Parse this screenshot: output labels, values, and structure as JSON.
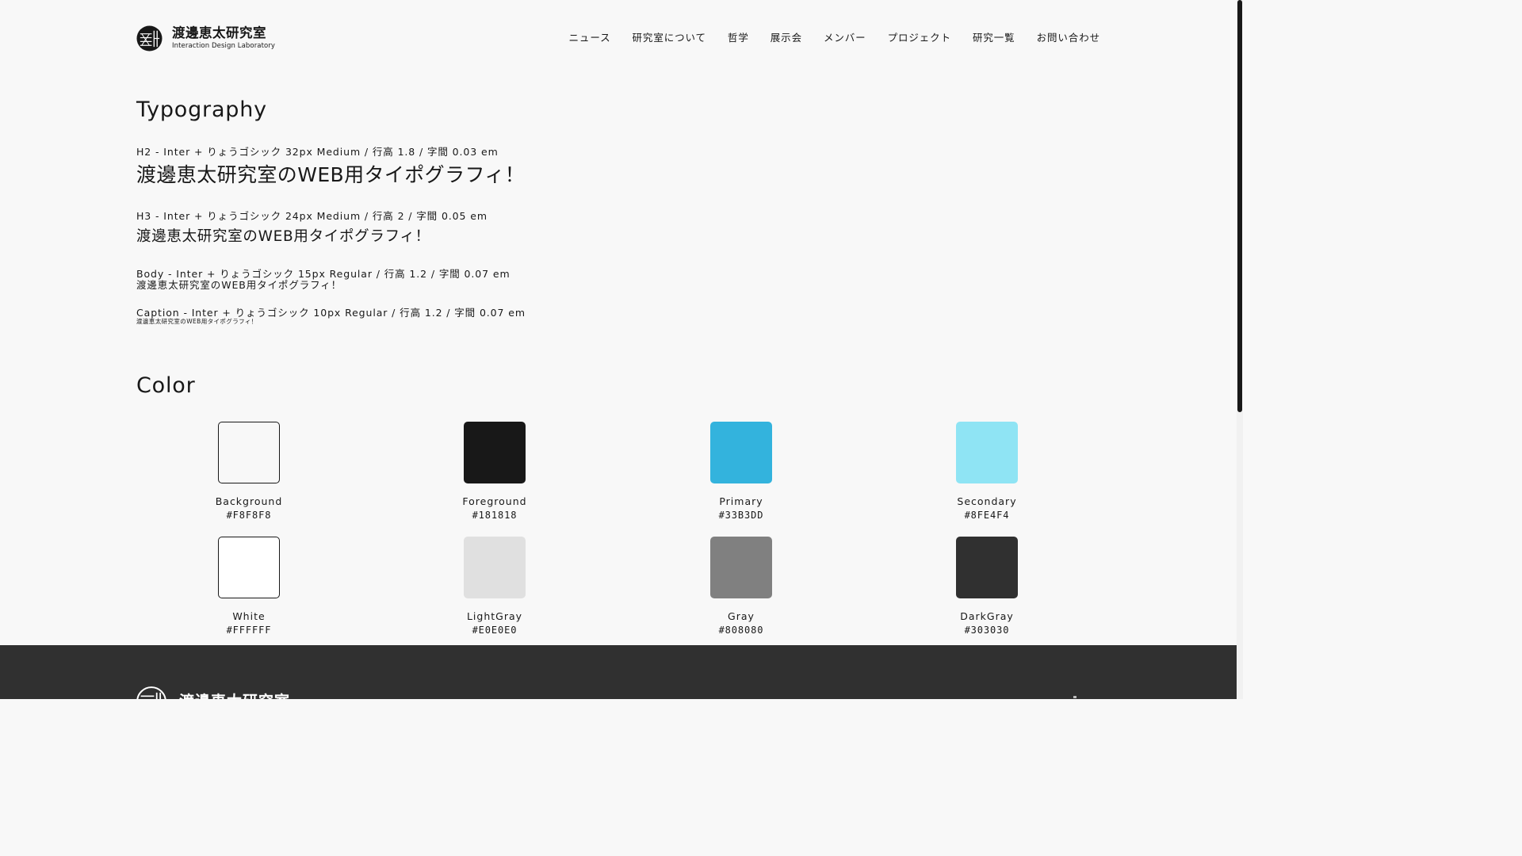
{
  "header": {
    "logo_jp": "渡邊恵太研究室",
    "logo_en": "Interaction Design Laboratory",
    "nav": [
      {
        "label": "ニュース"
      },
      {
        "label": "研究室について"
      },
      {
        "label": "哲学"
      },
      {
        "label": "展示会"
      },
      {
        "label": "メンバー"
      },
      {
        "label": "プロジェクト"
      },
      {
        "label": "研究一覧"
      },
      {
        "label": "お問い合わせ"
      }
    ]
  },
  "typography": {
    "heading": "Typography",
    "items": [
      {
        "spec": "H2 - Inter + りょうゴシック 32px Medium / 行高 1.8 / 字間 0.03 em",
        "sample": "渡邊恵太研究室のWEB用タイポグラフィ！"
      },
      {
        "spec": "H3 - Inter + りょうゴシック 24px Medium / 行高 2 / 字間 0.05 em",
        "sample": "渡邊恵太研究室のWEB用タイポグラフィ！"
      },
      {
        "spec": "Body - Inter + りょうゴシック 15px Regular / 行高 1.2 / 字間 0.07 em",
        "sample": "渡邊恵太研究室のWEB用タイポグラフィ！"
      },
      {
        "spec": "Caption - Inter + りょうゴシック 10px Regular / 行高 1.2 / 字間 0.07 em",
        "sample": "渡邊恵太研究室のWEB用タイポグラフィ！"
      }
    ]
  },
  "color": {
    "heading": "Color",
    "swatches": [
      {
        "name": "Background",
        "hex": "#F8F8F8",
        "color": "#F8F8F8"
      },
      {
        "name": "Foreground",
        "hex": "#181818",
        "color": "#181818"
      },
      {
        "name": "Primary",
        "hex": "#33B3DD",
        "color": "#33B3DD"
      },
      {
        "name": "Secondary",
        "hex": "#8FE4F4",
        "color": "#8FE4F4"
      },
      {
        "name": "White",
        "hex": "#FFFFFF",
        "color": "#FFFFFF"
      },
      {
        "name": "LightGray",
        "hex": "#E0E0E0",
        "color": "#E0E0E0"
      },
      {
        "name": "Gray",
        "hex": "#808080",
        "color": "#808080"
      },
      {
        "name": "DarkGray",
        "hex": "#303030",
        "color": "#303030"
      }
    ]
  },
  "footer": {
    "logo_jp": "渡邊恵太研究室"
  }
}
